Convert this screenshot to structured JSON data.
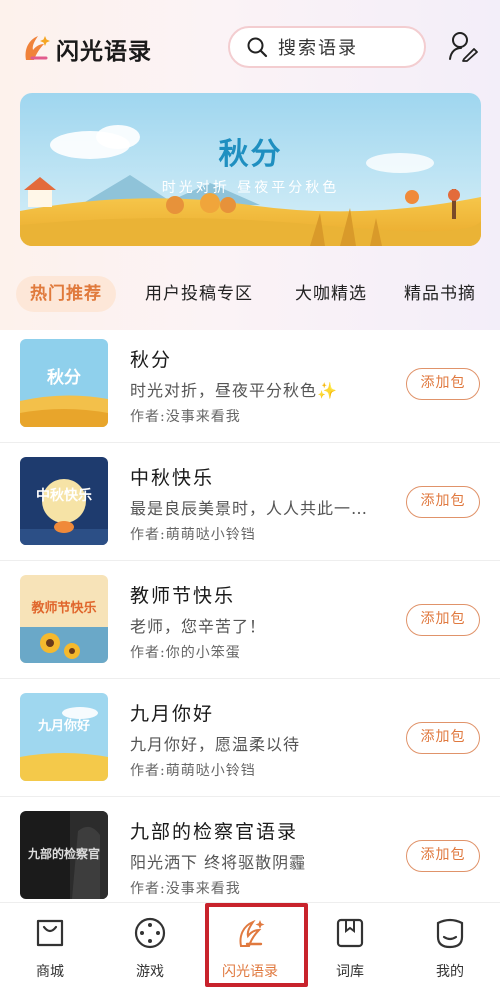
{
  "header": {
    "app_name": "闪光语录",
    "search_placeholder": "搜索语录"
  },
  "banner": {
    "title": "秋分",
    "subtitle": "时光对折 昼夜平分秋色"
  },
  "tabs": [
    {
      "label": "热门推荐",
      "active": true
    },
    {
      "label": "用户投稿专区",
      "active": false
    },
    {
      "label": "大咖精选",
      "active": false
    },
    {
      "label": "精品书摘",
      "active": false
    }
  ],
  "items": [
    {
      "title": "秋分",
      "desc": "时光对折，昼夜平分秋色✨",
      "author": "作者:没事来看我",
      "button": "添加包",
      "thumb_text": "秋分"
    },
    {
      "title": "中秋快乐",
      "desc": "最是良辰美景时，人人共此一轮明月",
      "author": "作者:萌萌哒小铃铛",
      "button": "添加包",
      "thumb_text": "中秋快乐"
    },
    {
      "title": "教师节快乐",
      "desc": "老师，您辛苦了！",
      "author": "作者:你的小笨蛋",
      "button": "添加包",
      "thumb_text": "教师节快乐"
    },
    {
      "title": "九月你好",
      "desc": "九月你好，愿温柔以待",
      "author": "作者:萌萌哒小铃铛",
      "button": "添加包",
      "thumb_text": "九月你好"
    },
    {
      "title": "九部的检察官语录",
      "desc": "阳光洒下 终将驱散阴霾",
      "author": "作者:没事来看我",
      "button": "添加包",
      "thumb_text": "九部的检察官"
    }
  ],
  "tabbar": [
    {
      "label": "商城",
      "icon": "shop-bag-icon"
    },
    {
      "label": "游戏",
      "icon": "game-icon"
    },
    {
      "label": "闪光语录",
      "icon": "flash-quote-icon",
      "active": true
    },
    {
      "label": "词库",
      "icon": "lexicon-icon"
    },
    {
      "label": "我的",
      "icon": "profile-icon"
    }
  ],
  "colors": {
    "accent": "#e0793f",
    "tab_active_bg": "#fde7d8",
    "highlight_box": "#c8232c"
  }
}
